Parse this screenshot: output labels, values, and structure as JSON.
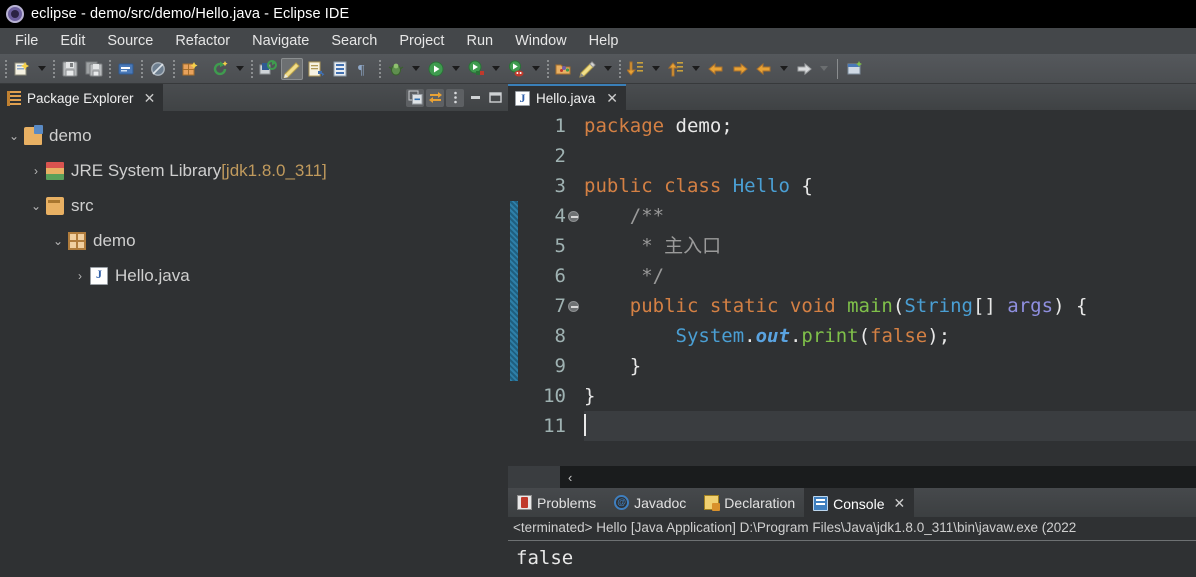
{
  "window": {
    "title": "eclipse - demo/src/demo/Hello.java - Eclipse IDE",
    "logo_icon": "eclipse-logo"
  },
  "menubar": {
    "items": [
      {
        "label": "File"
      },
      {
        "label": "Edit"
      },
      {
        "label": "Source"
      },
      {
        "label": "Refactor"
      },
      {
        "label": "Navigate"
      },
      {
        "label": "Search"
      },
      {
        "label": "Project"
      },
      {
        "label": "Run"
      },
      {
        "label": "Window"
      },
      {
        "label": "Help"
      }
    ]
  },
  "toolbar": {
    "buttons": [
      {
        "name": "new-wizard-icon"
      },
      {
        "name": "new-wizard-dropdown-icon"
      },
      {
        "name": "save-icon"
      },
      {
        "name": "save-all-icon"
      },
      {
        "name": "new-java-class-icon"
      },
      {
        "name": "skip-all-breakpoints-icon"
      },
      {
        "name": "new-java-package-icon"
      },
      {
        "name": "refresh-icon"
      },
      {
        "name": "refresh-dropdown-icon"
      },
      {
        "name": "open-type-icon"
      },
      {
        "name": "toggle-mark-occurrences-icon"
      },
      {
        "name": "next-annotation-icon"
      },
      {
        "name": "open-task-icon"
      },
      {
        "name": "show-whitespace-icon"
      },
      {
        "name": "debug-icon"
      },
      {
        "name": "debug-dropdown-icon"
      },
      {
        "name": "run-icon"
      },
      {
        "name": "run-dropdown-icon"
      },
      {
        "name": "coverage-icon"
      },
      {
        "name": "coverage-dropdown-icon"
      },
      {
        "name": "run-external-tools-icon"
      },
      {
        "name": "external-tools-dropdown-icon"
      },
      {
        "name": "open-perspective-icon"
      },
      {
        "name": "pencil-edit-icon"
      },
      {
        "name": "pencil-dropdown-icon"
      },
      {
        "name": "step-into-icon"
      },
      {
        "name": "step-into-dropdown-icon"
      },
      {
        "name": "step-out-icon"
      },
      {
        "name": "step-out-dropdown-icon"
      },
      {
        "name": "back-icon"
      },
      {
        "name": "forward-icon"
      },
      {
        "name": "previous-edit-icon"
      },
      {
        "name": "previous-dropdown-icon"
      },
      {
        "name": "next-edit-icon"
      },
      {
        "name": "next-dropdown-icon"
      },
      {
        "name": "new-window-icon"
      }
    ]
  },
  "package_explorer": {
    "tab_label": "Package Explorer",
    "tab_icon": "package-explorer-icon",
    "close_icon": "close-icon",
    "view_actions": [
      {
        "name": "collapse-all-icon"
      },
      {
        "name": "link-with-editor-icon"
      },
      {
        "name": "view-menu-icon"
      },
      {
        "name": "minimize-icon"
      },
      {
        "name": "maximize-icon"
      }
    ],
    "tree": [
      {
        "label": "demo",
        "suffix": "",
        "twisty": "v",
        "indent": 0,
        "icon": "java-project-icon"
      },
      {
        "label": "JRE System Library ",
        "suffix": "[jdk1.8.0_311]",
        "twisty": ">",
        "indent": 1,
        "icon": "jre-library-icon"
      },
      {
        "label": "src",
        "suffix": "",
        "twisty": "v",
        "indent": 1,
        "icon": "source-folder-icon"
      },
      {
        "label": "demo",
        "suffix": "",
        "twisty": "v",
        "indent": 2,
        "icon": "package-icon"
      },
      {
        "label": "Hello.java",
        "suffix": "",
        "twisty": ">",
        "indent": 3,
        "icon": "java-file-icon"
      }
    ]
  },
  "editor": {
    "tab_label": "Hello.java",
    "tab_icon": "java-file-icon",
    "close_icon": "close-icon",
    "fold_bar_from_line": 4,
    "fold_bar_to_line": 9,
    "current_line": 11,
    "scroll_left_icon": "scroll-left-arrow",
    "lines": [
      {
        "num": "1",
        "fold": false
      },
      {
        "num": "2",
        "fold": false
      },
      {
        "num": "3",
        "fold": false
      },
      {
        "num": "4",
        "fold": true
      },
      {
        "num": "5",
        "fold": false
      },
      {
        "num": "6",
        "fold": false
      },
      {
        "num": "7",
        "fold": true
      },
      {
        "num": "8",
        "fold": false
      },
      {
        "num": "9",
        "fold": false
      },
      {
        "num": "10",
        "fold": false
      },
      {
        "num": "11",
        "fold": false
      }
    ],
    "code": {
      "l1_kw": "package",
      "l1_name": " demo;",
      "l3_kw1": "public",
      "l3_kw2": " class ",
      "l3_cls": "Hello",
      "l3_brace": " {",
      "l4": "    /**",
      "l5": "     * 主入口",
      "l6": "     */",
      "l7_kw": "    public static void ",
      "l7_fn": "main",
      "l7_p1": "(",
      "l7_cls": "String",
      "l7_p2": "[] ",
      "l7_arg": "args",
      "l7_p3": ") {",
      "l8_sys": "        System",
      "l8_dot1": ".",
      "l8_out": "out",
      "l8_dot2": ".",
      "l8_print": "print",
      "l8_p1": "(",
      "l8_false": "false",
      "l8_p2": ");",
      "l9": "    }",
      "l10": "}",
      "l11": ""
    }
  },
  "bottom_panel": {
    "tabs": [
      {
        "label": "Problems",
        "icon": "problems-icon",
        "active": false
      },
      {
        "label": "Javadoc",
        "icon": "javadoc-icon",
        "active": false
      },
      {
        "label": "Declaration",
        "icon": "declaration-icon",
        "active": false
      },
      {
        "label": "Console",
        "icon": "console-icon",
        "active": true
      }
    ],
    "close_icon": "close-icon",
    "console_title": "<terminated> Hello [Java Application] D:\\Program Files\\Java\\jdk1.8.0_311\\bin\\javaw.exe  (2022",
    "console_output": "false"
  },
  "colors": {
    "titlebar_bg": "#000000",
    "menubar_bg": "#44474a",
    "editor_bg": "#2f3133",
    "keyword": "#d48044",
    "class_name": "#4a9fd4",
    "method": "#7fc04a",
    "field_italic": "#5aa3e0",
    "variable": "#8f8fe0",
    "comment": "#9a9a9a",
    "tree_suffix": "#c09a5d",
    "active_tab_border": "#3a7fb8",
    "fold_bar": "#2e7fa8"
  }
}
